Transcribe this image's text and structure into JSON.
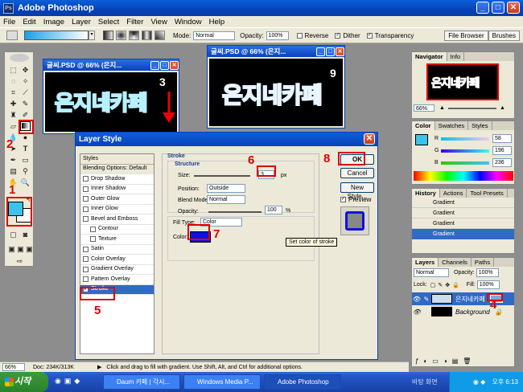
{
  "app": {
    "title": "Adobe Photoshop"
  },
  "menu": [
    "File",
    "Edit",
    "Image",
    "Layer",
    "Select",
    "Filter",
    "View",
    "Window",
    "Help"
  ],
  "options": {
    "mode_label": "Mode:",
    "mode_value": "Normal",
    "opacity_label": "Opacity:",
    "opacity_value": "100%",
    "reverse": "Reverse",
    "dither": "Dither",
    "transparency": "Transparency",
    "file_browser": "File Browser",
    "brushes": "Brushes"
  },
  "doc1": {
    "title": "글씨.PSD @ 66% (은지...",
    "text": "은지네카페",
    "layer_num": "3"
  },
  "doc2": {
    "title": "글씨.PSD @ 66% (은지...",
    "text": "은지네카페",
    "layer_num": "9"
  },
  "navigator": {
    "tabs": [
      "Navigator",
      "Info"
    ],
    "zoom": "66%",
    "thumb_text": "은지네카페"
  },
  "color": {
    "tabs": [
      "Color",
      "Swatches",
      "Styles"
    ],
    "r_label": "R",
    "r": "58",
    "g_label": "G",
    "g": "196",
    "b_label": "B",
    "b": "236",
    "fg": "#3ac4ec"
  },
  "history": {
    "tabs": [
      "History",
      "Actions",
      "Tool Presets"
    ],
    "items": [
      "Gradient",
      "Gradient",
      "Gradient",
      "Gradient"
    ]
  },
  "layers": {
    "tabs": [
      "Layers",
      "Channels",
      "Paths"
    ],
    "blend": "Normal",
    "opacity_label": "Opacity:",
    "opacity": "100%",
    "lock_label": "Lock:",
    "fill_label": "Fill:",
    "fill": "100%",
    "rows": [
      {
        "name": "은지네카페"
      },
      {
        "name": "Background"
      }
    ]
  },
  "dialog": {
    "title": "Layer Style",
    "styles_header": "Styles",
    "blending": "Blending Options: Default",
    "effects": [
      {
        "label": "Drop Shadow",
        "sub": false
      },
      {
        "label": "Inner Shadow",
        "sub": false
      },
      {
        "label": "Outer Glow",
        "sub": false
      },
      {
        "label": "Inner Glow",
        "sub": false
      },
      {
        "label": "Bevel and Emboss",
        "sub": false
      },
      {
        "label": "Contour",
        "sub": true
      },
      {
        "label": "Texture",
        "sub": true
      },
      {
        "label": "Satin",
        "sub": false
      },
      {
        "label": "Color Overlay",
        "sub": false
      },
      {
        "label": "Gradient Overlay",
        "sub": false
      },
      {
        "label": "Pattern Overlay",
        "sub": false
      }
    ],
    "stroke_item": "Stroke",
    "stroke_header": "Stroke",
    "structure": "Structure",
    "size_label": "Size:",
    "size_value": "3",
    "px": "px",
    "position_label": "Position:",
    "position_value": "Outside",
    "blend_label": "Blend Mode:",
    "blend_value": "Normal",
    "opacity_label": "Opacity:",
    "opacity_value": "100",
    "percent": "%",
    "fill_type_label": "Fill Type:",
    "fill_type_value": "Color",
    "color_label": "Color:",
    "stroke_color": "#1010e0",
    "ok": "OK",
    "cancel": "Cancel",
    "new_style": "New Style...",
    "preview": "Preview",
    "tooltip": "Set color of stroke"
  },
  "annotations": [
    "1",
    "2",
    "3",
    "4",
    "5",
    "6",
    "7",
    "8",
    "9"
  ],
  "status": {
    "zoom": "66%",
    "doc": "Doc: 234K/313K",
    "hint": "Click and drag to fill with gradient. Use Shift, Alt, and Ctrl for additional options."
  },
  "taskbar": {
    "start": "시작",
    "items": [
      "Daum 카페 | 각시...",
      "Windows Media P...",
      "Adobe Photoshop"
    ],
    "desktop": "바탕 화면",
    "clock": "오후 6:13"
  }
}
